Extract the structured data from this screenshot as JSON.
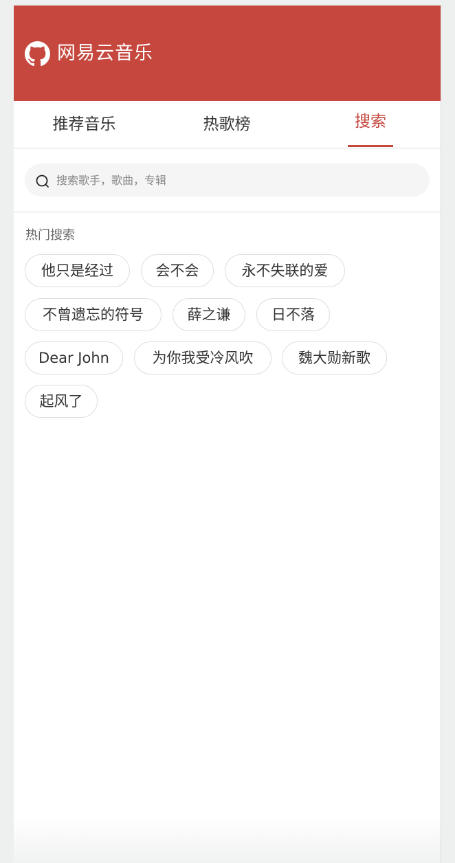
{
  "header": {
    "logo_icon": "github-icon",
    "title": "网易云音乐",
    "background_color": "#c5473d"
  },
  "tabs": [
    {
      "label": "推荐音乐",
      "active": false
    },
    {
      "label": "热歌榜",
      "active": false
    },
    {
      "label": "搜索",
      "active": true
    }
  ],
  "accent_color": "#c5473d",
  "search": {
    "icon": "search-icon",
    "value": "",
    "placeholder": "搜索歌手，歌曲，专辑"
  },
  "hot_search": {
    "title": "热门搜索",
    "tags": [
      "他只是经过",
      "会不会",
      "永不失联的爱",
      "不曾遗忘的符号",
      "薛之谦",
      "日不落",
      "Dear John",
      "为你我受冷风吹",
      "魏大勋新歌",
      "起风了"
    ]
  }
}
